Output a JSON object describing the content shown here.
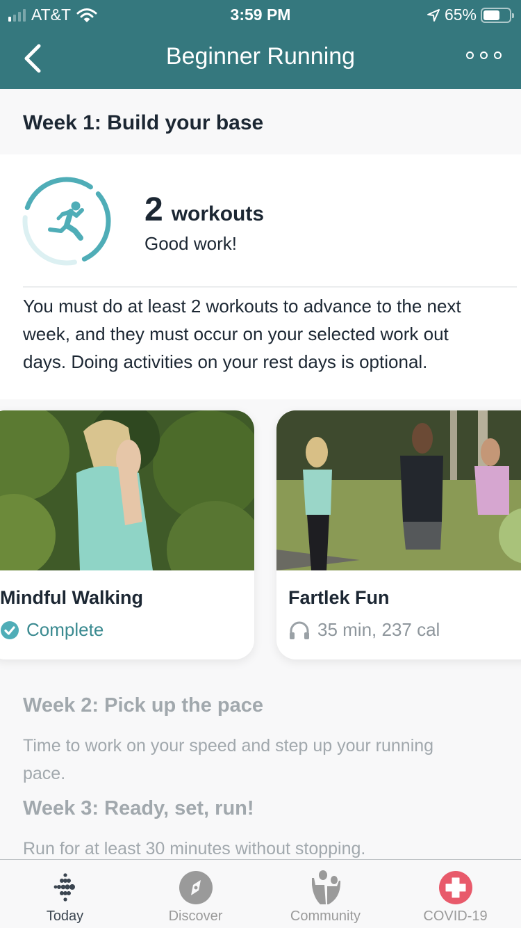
{
  "status_bar": {
    "carrier": "AT&T",
    "time": "3:59 PM",
    "battery_percent_label": "65%",
    "battery_level": 0.65,
    "signal_bars_active": 1,
    "signal_bars_total": 4
  },
  "nav": {
    "title": "Beginner Running",
    "back_icon": "chevron-left-icon",
    "more_icon": "more-dots-icon"
  },
  "week1": {
    "title": "Week 1: Build your base",
    "progress": {
      "count": "2",
      "label": "workouts",
      "message": "Good work!",
      "completed_segments": 2,
      "total_segments": 3,
      "icon": "runner-icon"
    },
    "description": "You must do at least 2 workouts to advance to the next week, and they must occur on your selected work out days. Doing activities on your rest days is optional."
  },
  "workouts": [
    {
      "title": "Mindful Walking",
      "status": "Complete",
      "status_icon": "check-circle-icon"
    },
    {
      "title": "Fartlek Fun",
      "status": "35 min, 237 cal",
      "status_icon": "headphones-icon"
    }
  ],
  "upcoming_weeks": [
    {
      "title": "Week 2: Pick up the pace",
      "description": "Time to work on your speed and step up your running pace."
    },
    {
      "title": "Week 3: Ready, set, run!",
      "description": "Run for at least 30 minutes without stopping."
    }
  ],
  "tab_bar": {
    "tabs": [
      {
        "label": "Today",
        "icon": "fitbit-logo-icon",
        "active": true
      },
      {
        "label": "Discover",
        "icon": "compass-icon",
        "active": false
      },
      {
        "label": "Community",
        "icon": "community-icon",
        "active": false
      },
      {
        "label": "COVID-19",
        "icon": "medical-cross-icon",
        "active": false
      }
    ]
  },
  "colors": {
    "header_teal": "#35787e",
    "accent_teal": "#4fadb7",
    "text_dark": "#1c2733",
    "text_muted": "#a1a8ad",
    "covid_red": "#e85a6b"
  }
}
